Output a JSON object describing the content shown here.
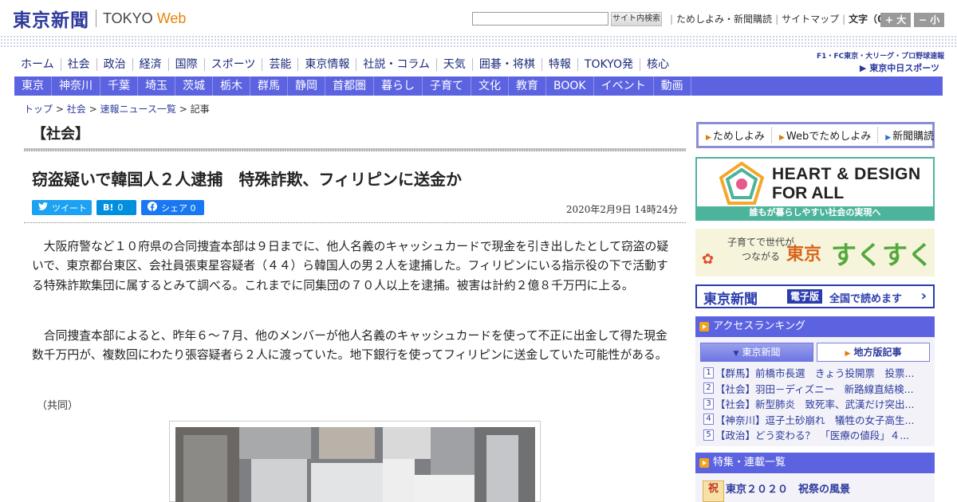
{
  "header": {
    "logo_jp": "東京新聞",
    "logo_en": "TOKYO",
    "logo_web": "Web",
    "search_placeholder": "",
    "search_button": "サイト内検索",
    "links": [
      "ためしよみ・新聞購読",
      "サイトマップ"
    ],
    "font_size_label": "文字（0）",
    "font_plus": "+ 大",
    "font_minus": "− 小"
  },
  "nav_main": [
    "ホーム",
    "社会",
    "政治",
    "経済",
    "国際",
    "スポーツ",
    "芸能",
    "東京情報",
    "社説・コラム",
    "天気",
    "囲碁・将棋",
    "特報",
    "TOKYO発",
    "核心"
  ],
  "chunichi": {
    "line1": "F1・FC東京・大リーグ・プロ野球速報",
    "line2": "▶ 東京中日スポーツ"
  },
  "nav_regional": [
    "東京",
    "神奈川",
    "千葉",
    "埼玉",
    "茨城",
    "栃木",
    "群馬",
    "静岡",
    "首都圏",
    "暮らし",
    "子育て",
    "文化",
    "教育",
    "BOOK",
    "イベント",
    "動画"
  ],
  "breadcrumb": {
    "items": [
      "トップ",
      "社会",
      "速報ニュース一覧"
    ],
    "current": "記事",
    "sep": ">"
  },
  "section_title": "【社会】",
  "article": {
    "headline": "窃盗疑いで韓国人２人逮捕　特殊詐欺、フィリピンに送金か",
    "date": "2020年2月9日 14時24分",
    "paragraphs": [
      "大阪府警など１０府県の合同捜査本部は９日までに、他人名義のキャッシュカードで現金を引き出したとして窃盗の疑いで、東京都台東区、会社員張東星容疑者（４４）ら韓国人の男２人を逮捕した。フィリピンにいる指示役の下で活動する特殊詐欺集団に属するとみて調べる。これまでに同集団の７０人以上を逮捕。被害は計約２億８千万円に上る。",
      "合同捜査本部によると、昨年６～７月、他のメンバーが他人名義のキャッシュカードを使って不正に出金して得た現金数千万円が、複数回にわたり張容疑者ら２人に渡っていた。地下銀行を使ってフィリピンに送金していた可能性がある。"
    ],
    "credit": "（共同）"
  },
  "share": {
    "tweet": "ツイート",
    "hatena_icon": "B!",
    "hatena_count": "0",
    "facebook": "シェア 0"
  },
  "sidebar": {
    "tameshi": [
      "ためしよみ",
      "Webでためしよみ",
      "新聞購読"
    ],
    "heart_line1": "HEART & DESIGN",
    "heart_line2": "FOR ALL",
    "heart_band": "誰もが暮らしやすい社会の実現へ",
    "suku_line1": "子育てで世代が",
    "suku_line2": "つながる",
    "suku_tokyo": "東京",
    "suku_big": "すくすく",
    "denshi_logo": "東京新聞",
    "denshi_tag": "電子版",
    "denshi_text": "全国で読めます",
    "denshi_arrow": "›",
    "ranking_title": "アクセスランキング",
    "ranking_tabs": [
      "東京新聞",
      "地方版記事"
    ],
    "ranking": [
      {
        "num": "1",
        "text": "【群馬】前橋市長選　きょう投開票　投票..."
      },
      {
        "num": "2",
        "text": "【社会】羽田－ディズニー　新路線直結検..."
      },
      {
        "num": "3",
        "text": "【社会】新型肺炎　致死率、武漢だけ突出..."
      },
      {
        "num": "4",
        "text": "【神奈川】逗子土砂崩れ　犠牲の女子高生..."
      },
      {
        "num": "5",
        "text": "【政治】どう変わる？　「医療の値段」４..."
      }
    ],
    "feature_title": "特集・連載一覧",
    "feature_item": "東京２０２０　祝祭の風景",
    "feature_thumb": "祝"
  },
  "colors": {
    "brand_blue": "#2d3a9c",
    "nav_bar": "#5c63e0",
    "accent_orange": "#e8830c",
    "heart_green": "#4db49c"
  }
}
